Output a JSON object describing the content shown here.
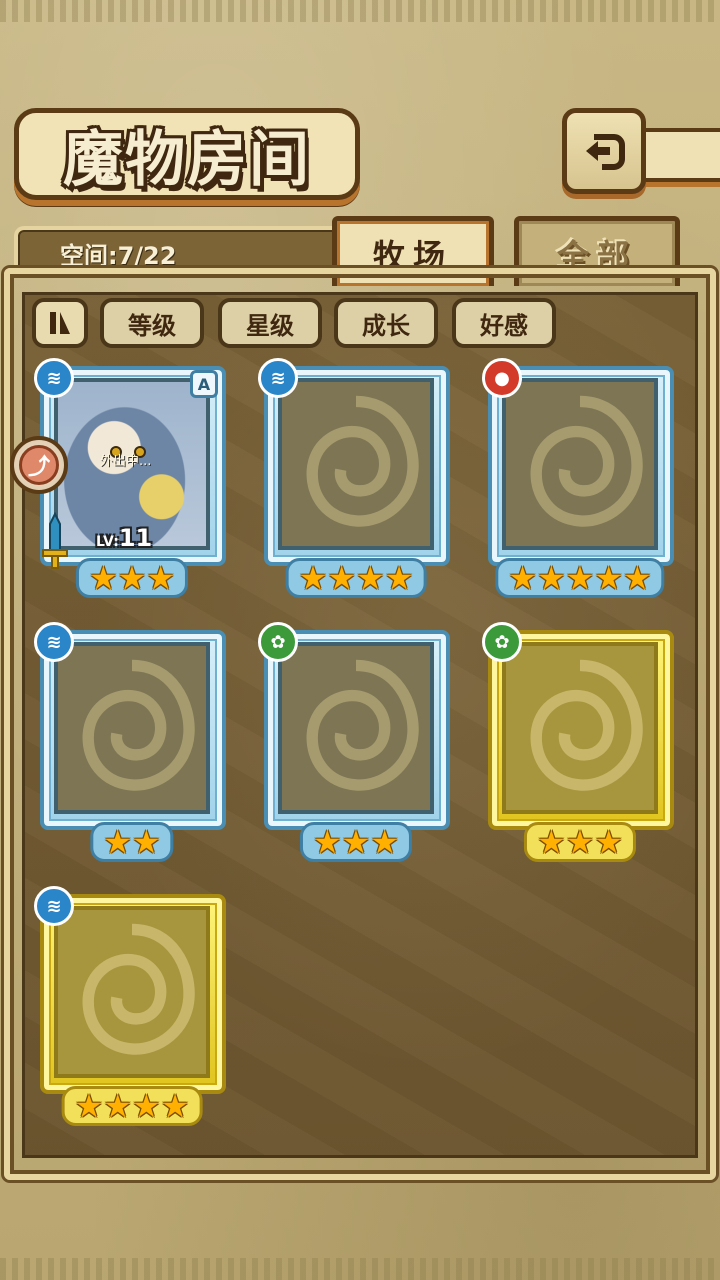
{
  "header": {
    "title": "魔物房间",
    "back_icon": "back-arrow-icon"
  },
  "space": {
    "label": "空间:7/22"
  },
  "tabs": [
    {
      "label": "牧场",
      "active": true
    },
    {
      "label": "全部",
      "active": false
    }
  ],
  "sort": {
    "toggle_icon": "ll",
    "buttons": [
      "等级",
      "星级",
      "成长",
      "好感"
    ]
  },
  "cards": [
    {
      "frame": "blue",
      "element": "water",
      "element_color": "#2a86c8",
      "stars": "★★★",
      "featured": true,
      "rank": "A",
      "status": "外出中...",
      "level_prefix": "LV:",
      "level": "11"
    },
    {
      "frame": "blue",
      "element": "water",
      "element_color": "#2a86c8",
      "stars": "★★★★"
    },
    {
      "frame": "blue",
      "element": "fire",
      "element_color": "#d33a2a",
      "stars": "★★★★★"
    },
    {
      "frame": "blue",
      "element": "water",
      "element_color": "#2a86c8",
      "stars": "★★"
    },
    {
      "frame": "blue",
      "element": "wood",
      "element_color": "#3c9a3a",
      "stars": "★★★"
    },
    {
      "frame": "gold",
      "element": "wood",
      "element_color": "#3c9a3a",
      "stars": "★★★"
    },
    {
      "frame": "gold",
      "element": "water",
      "element_color": "#2a86c8",
      "stars": "★★★★"
    }
  ]
}
